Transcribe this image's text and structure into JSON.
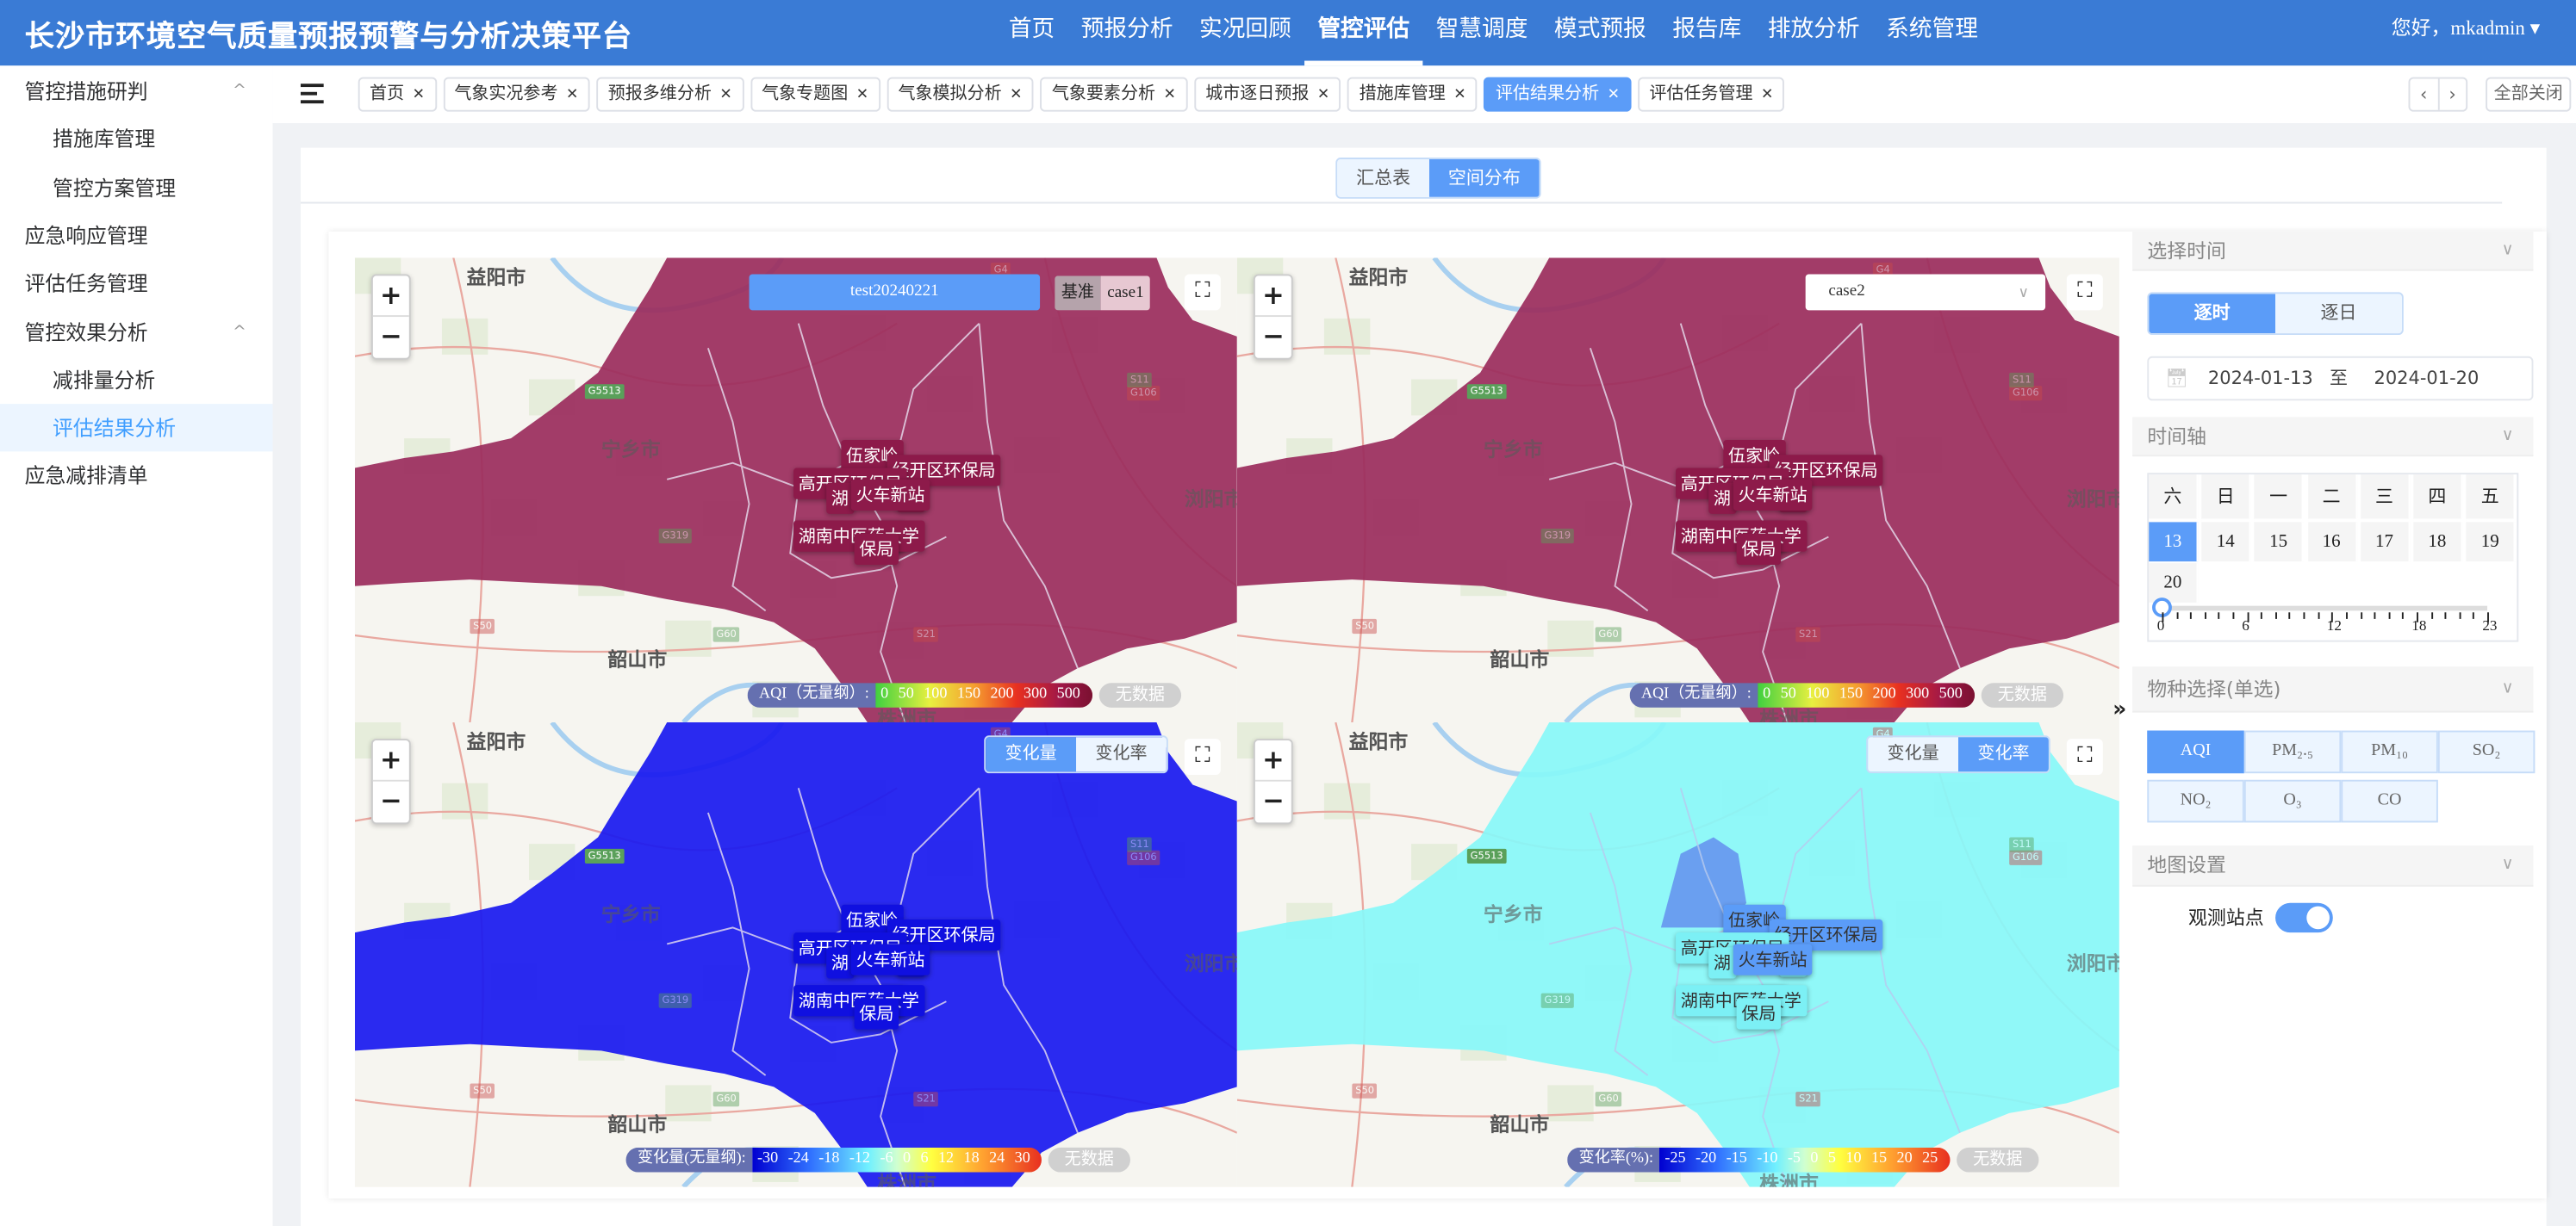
{
  "app": {
    "title": "长沙市环境空气质量预报预警与分析决策平台",
    "user": "您好，mkadmin ▾"
  },
  "nav": [
    {
      "label": "首页"
    },
    {
      "label": "预报分析"
    },
    {
      "label": "实况回顾"
    },
    {
      "label": "管控评估",
      "active": true
    },
    {
      "label": "智慧调度"
    },
    {
      "label": "模式预报"
    },
    {
      "label": "报告库"
    },
    {
      "label": "排放分析"
    },
    {
      "label": "系统管理"
    }
  ],
  "sidebar": [
    {
      "label": "管控措施研判",
      "level": 1,
      "expanded": true
    },
    {
      "label": "措施库管理",
      "level": 2
    },
    {
      "label": "管控方案管理",
      "level": 2
    },
    {
      "label": "应急响应管理",
      "level": 1
    },
    {
      "label": "评估任务管理",
      "level": 1
    },
    {
      "label": "管控效果分析",
      "level": 1,
      "expanded": true
    },
    {
      "label": "减排量分析",
      "level": 2
    },
    {
      "label": "评估结果分析",
      "level": 2,
      "active": true
    },
    {
      "label": "应急减排清单",
      "level": 1
    }
  ],
  "tabs": [
    {
      "label": "首页"
    },
    {
      "label": "气象实况参考"
    },
    {
      "label": "预报多维分析"
    },
    {
      "label": "气象专题图"
    },
    {
      "label": "气象模拟分析"
    },
    {
      "label": "气象要素分析"
    },
    {
      "label": "城市逐日预报"
    },
    {
      "label": "措施库管理"
    },
    {
      "label": "评估结果分析",
      "active": true
    },
    {
      "label": "评估任务管理"
    }
  ],
  "tab_close_all": "全部关闭",
  "view_toggle": {
    "options": [
      "汇总表",
      "空间分布"
    ],
    "selected": "空间分布"
  },
  "maps": {
    "places": {
      "yiyang": "益阳市",
      "ningxiang": "宁乡市",
      "shaoshan": "韶山市",
      "zhuzhou": "株洲市",
      "liuyang": "浏阳市"
    },
    "shields": [
      "G5513",
      "S50",
      "G60",
      "S21",
      "G319",
      "G106",
      "S11",
      "G4"
    ],
    "stations": [
      "伍家岭",
      "经开区环保局",
      "高开区环保局",
      "湖",
      "岭",
      "火车新站",
      "局",
      "湖南中医药大学",
      "保局"
    ],
    "top_left": {
      "scenario": "test20240221",
      "base_label": "基准",
      "base_value": "case1",
      "fill": "#9b2d5e"
    },
    "top_right": {
      "scenario": "case2",
      "fill": "#9b2d5e"
    },
    "bottom_left": {
      "options": [
        "变化量",
        "变化率"
      ],
      "selected": "变化量",
      "fill": "#1a1af0"
    },
    "bottom_right": {
      "options": [
        "变化量",
        "变化率"
      ],
      "selected": "变化率",
      "fill": "#88f7f9",
      "hotspot": "#6a9ff0"
    },
    "legend_aqi": {
      "label": "AQI（无量纲）:",
      "ticks": [
        "0",
        "50",
        "100",
        "150",
        "200",
        "300",
        "500"
      ]
    },
    "legend_change": {
      "label": "变化量(无量纲):",
      "ticks": [
        "-30",
        "-24",
        "-18",
        "-12",
        "-6",
        "0",
        "6",
        "12",
        "18",
        "24",
        "30"
      ]
    },
    "legend_rate": {
      "label": "变化率(%):",
      "ticks": [
        "-25",
        "-20",
        "-15",
        "-10",
        "-5",
        "0",
        "5",
        "10",
        "15",
        "20",
        "25"
      ]
    },
    "nodata": "无数据"
  },
  "side": {
    "time_title": "选择时间",
    "time_mode": {
      "options": [
        "逐时",
        "逐日"
      ],
      "selected": "逐时"
    },
    "date_start": "2024-01-13",
    "date_sep": "至",
    "date_end": "2024-01-20",
    "axis_title": "时间轴",
    "weekdays": [
      "六",
      "日",
      "一",
      "二",
      "三",
      "四",
      "五"
    ],
    "days": [
      "13",
      "14",
      "15",
      "16",
      "17",
      "18",
      "19",
      "20"
    ],
    "selected_day": "13",
    "hour_labels": [
      "0",
      "6",
      "12",
      "18",
      "23"
    ],
    "hour_value": 0,
    "species_title": "物种选择(单选)",
    "species": [
      "AQI",
      "PM₂.₅",
      "PM₁₀",
      "SO₂",
      "NO₂",
      "O₃",
      "CO"
    ],
    "species_selected": "AQI",
    "map_title": "地图设置",
    "stations_label": "观测站点",
    "stations_on": true
  }
}
